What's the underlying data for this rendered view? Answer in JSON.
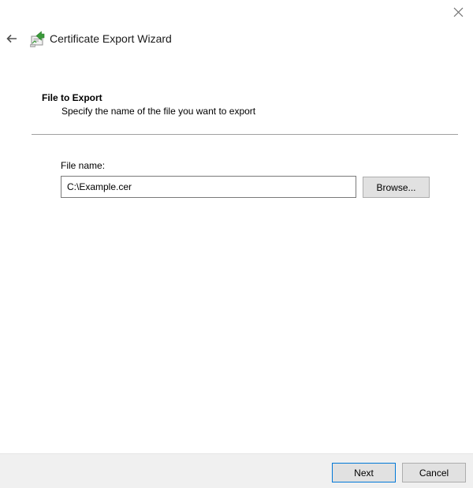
{
  "window": {
    "close_icon": "close-icon"
  },
  "header": {
    "back_icon": "back-arrow-icon",
    "wizard_icon": "certificate-icon",
    "title": "Certificate Export Wizard"
  },
  "section": {
    "title": "File to Export",
    "subtitle": "Specify the name of the file you want to export"
  },
  "file": {
    "label": "File name:",
    "value": "C:\\Example.cer",
    "browse_label": "Browse..."
  },
  "footer": {
    "next_label": "Next",
    "cancel_label": "Cancel"
  },
  "colors": {
    "footer_background": "#f0f0f0",
    "button_background": "#e1e1e1",
    "default_button_border": "#0078d7",
    "icon_green": "#3a9a3a"
  }
}
